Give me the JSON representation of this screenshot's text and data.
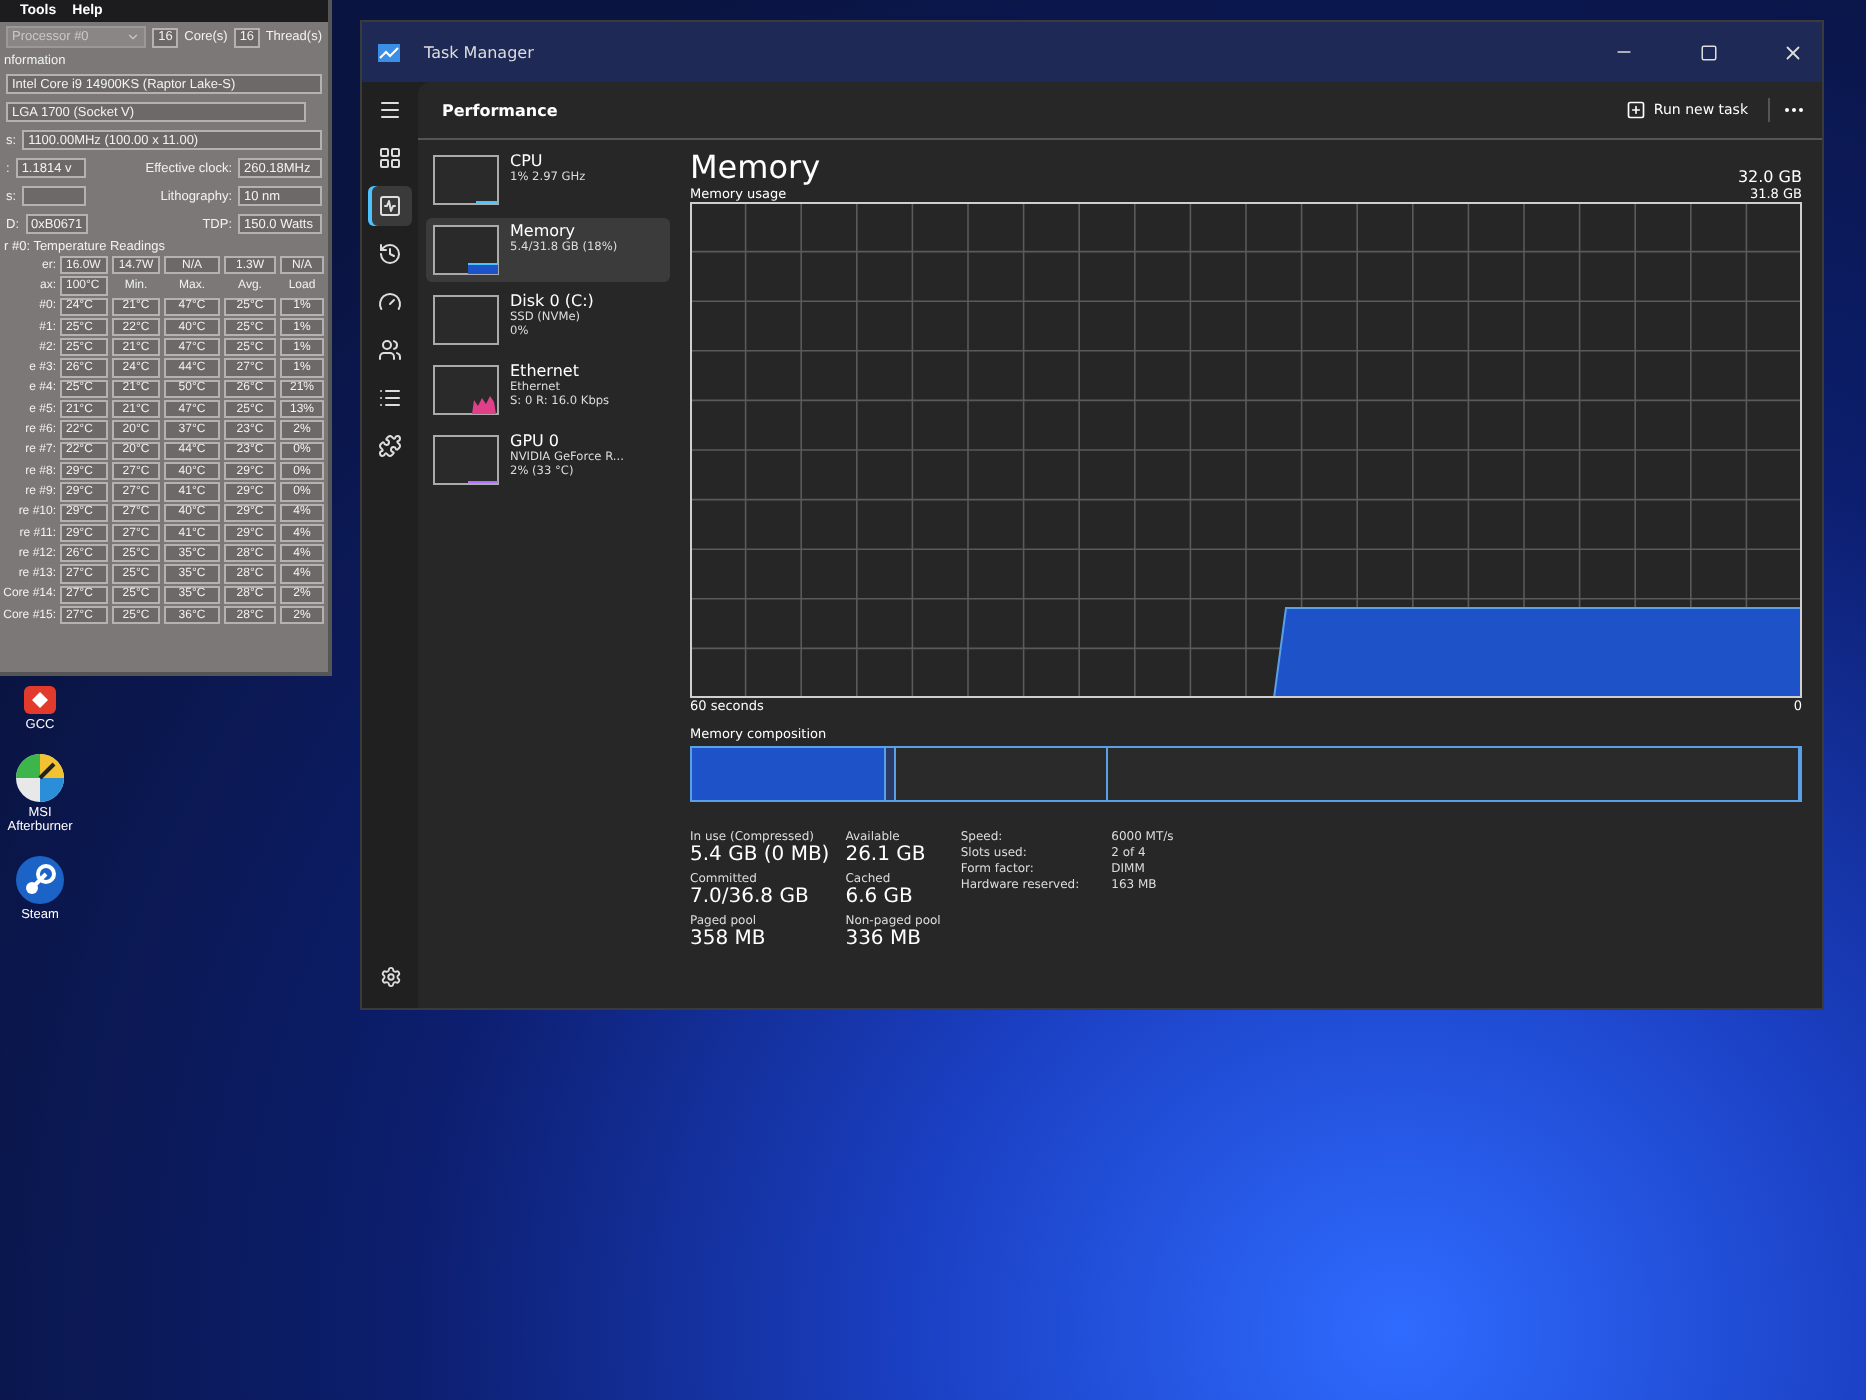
{
  "coretemp": {
    "menu": [
      "Tools",
      "Help"
    ],
    "processor": "Processor #0",
    "cores": "16",
    "cores_label": "Core(s)",
    "threads": "16",
    "threads_label": "Thread(s)",
    "info_heading": "nformation",
    "model": "Intel Core i9 14900KS (Raptor Lake-S)",
    "platform": "LGA 1700 (Socket V)",
    "freq_label": "s:",
    "frequency": "1100.00MHz (100.00 x 11.00)",
    "vid_label": ":",
    "vid": "1.1814 v",
    "rev_label": "s:",
    "id_label": "D:",
    "id": "0xB0671",
    "specs": [
      {
        "label": "Effective clock:",
        "value": "260.18MHz"
      },
      {
        "label": "Lithography:",
        "value": "10 nm"
      },
      {
        "label": "TDP:",
        "value": "150.0 Watts"
      }
    ],
    "temp_heading": "r #0: Temperature Readings",
    "power": {
      "label": "er:",
      "values": [
        "16.0W",
        "14.7W",
        "N/A",
        "1.3W",
        "N/A"
      ]
    },
    "tjmax": {
      "label": "ax:",
      "value": "100°C",
      "columns": [
        "Min.",
        "Max.",
        "Avg.",
        "Load"
      ]
    },
    "cores_rows": [
      {
        "label": "#0:",
        "values": [
          "24°C",
          "21°C",
          "47°C",
          "25°C",
          "1%"
        ]
      },
      {
        "label": "#1:",
        "values": [
          "25°C",
          "22°C",
          "40°C",
          "25°C",
          "1%"
        ]
      },
      {
        "label": "#2:",
        "values": [
          "25°C",
          "21°C",
          "47°C",
          "25°C",
          "1%"
        ]
      },
      {
        "label": "e #3:",
        "values": [
          "26°C",
          "24°C",
          "44°C",
          "27°C",
          "1%"
        ]
      },
      {
        "label": "e #4:",
        "values": [
          "25°C",
          "21°C",
          "50°C",
          "26°C",
          "21%"
        ]
      },
      {
        "label": "e #5:",
        "values": [
          "21°C",
          "21°C",
          "47°C",
          "25°C",
          "13%"
        ]
      },
      {
        "label": "re #6:",
        "values": [
          "22°C",
          "20°C",
          "37°C",
          "23°C",
          "2%"
        ]
      },
      {
        "label": "re #7:",
        "values": [
          "22°C",
          "20°C",
          "44°C",
          "23°C",
          "0%"
        ]
      },
      {
        "label": "re #8:",
        "values": [
          "29°C",
          "27°C",
          "40°C",
          "29°C",
          "0%"
        ]
      },
      {
        "label": "re #9:",
        "values": [
          "29°C",
          "27°C",
          "41°C",
          "29°C",
          "0%"
        ]
      },
      {
        "label": "re #10:",
        "values": [
          "29°C",
          "27°C",
          "40°C",
          "29°C",
          "4%"
        ]
      },
      {
        "label": "re #11:",
        "values": [
          "29°C",
          "27°C",
          "41°C",
          "29°C",
          "4%"
        ]
      },
      {
        "label": "re #12:",
        "values": [
          "26°C",
          "25°C",
          "35°C",
          "28°C",
          "4%"
        ]
      },
      {
        "label": "re #13:",
        "values": [
          "27°C",
          "25°C",
          "35°C",
          "28°C",
          "4%"
        ]
      },
      {
        "label": "Core #14:",
        "values": [
          "27°C",
          "25°C",
          "35°C",
          "28°C",
          "2%"
        ]
      },
      {
        "label": "Core #15:",
        "values": [
          "27°C",
          "25°C",
          "36°C",
          "28°C",
          "2%"
        ]
      }
    ]
  },
  "desktop_icons": [
    {
      "kind": "gcc",
      "label": "GCC"
    },
    {
      "kind": "afterburner",
      "label": "MSI Afterburner"
    },
    {
      "kind": "steam",
      "label": "Steam"
    }
  ],
  "task_manager": {
    "title": "Task Manager",
    "nav": [
      {
        "kind": "menu",
        "selected": false
      },
      {
        "kind": "processes",
        "selected": false
      },
      {
        "kind": "performance",
        "selected": true
      },
      {
        "kind": "history",
        "selected": false
      },
      {
        "kind": "startup",
        "selected": false
      },
      {
        "kind": "users",
        "selected": false
      },
      {
        "kind": "details",
        "selected": false
      },
      {
        "kind": "services",
        "selected": false
      }
    ],
    "section": "Performance",
    "run_new_task": "Run new task",
    "resources": [
      {
        "kind": "cpu",
        "name": "CPU",
        "lines": [
          "1% 2.97 GHz"
        ],
        "selected": false
      },
      {
        "kind": "memory",
        "name": "Memory",
        "lines": [
          "5.4/31.8 GB (18%)"
        ],
        "selected": true
      },
      {
        "kind": "disk",
        "name": "Disk 0 (C:)",
        "lines": [
          "SSD (NVMe)",
          "0%"
        ],
        "selected": false
      },
      {
        "kind": "ethernet",
        "name": "Ethernet",
        "lines": [
          "Ethernet",
          "S: 0 R: 16.0 Kbps"
        ],
        "selected": false
      },
      {
        "kind": "gpu",
        "name": "GPU 0",
        "lines": [
          "NVIDIA GeForce R...",
          "2% (33 °C)"
        ],
        "selected": false
      }
    ],
    "detail": {
      "title": "Memory",
      "total": "32.0 GB",
      "usage_label": "Memory usage",
      "usage_max": "31.8 GB",
      "time_label": "60 seconds",
      "time_end": "0",
      "composition_label": "Memory composition",
      "composition": [
        {
          "kind": "in_use",
          "level": 0.175
        },
        {
          "kind": "modified",
          "level": 0.01
        },
        {
          "kind": "standby",
          "level": 0.19
        },
        {
          "kind": "free",
          "level": 0.625
        }
      ],
      "stats": [
        [
          {
            "label": "In use (Compressed)",
            "value": "5.4 GB (0 MB)"
          },
          {
            "label": "Available",
            "value": "26.1 GB"
          }
        ],
        [
          {
            "label": "Committed",
            "value": "7.0/36.8 GB"
          },
          {
            "label": "Cached",
            "value": "6.6 GB"
          }
        ],
        [
          {
            "label": "Paged pool",
            "value": "358 MB"
          },
          {
            "label": "Non-paged pool",
            "value": "336 MB"
          }
        ]
      ],
      "specs": [
        {
          "label": "Speed:",
          "value": "6000 MT/s"
        },
        {
          "label": "Slots used:",
          "value": "2 of 4"
        },
        {
          "label": "Form factor:",
          "value": "DIMM"
        },
        {
          "label": "Hardware reserved:",
          "value": "163 MB"
        }
      ]
    }
  }
}
